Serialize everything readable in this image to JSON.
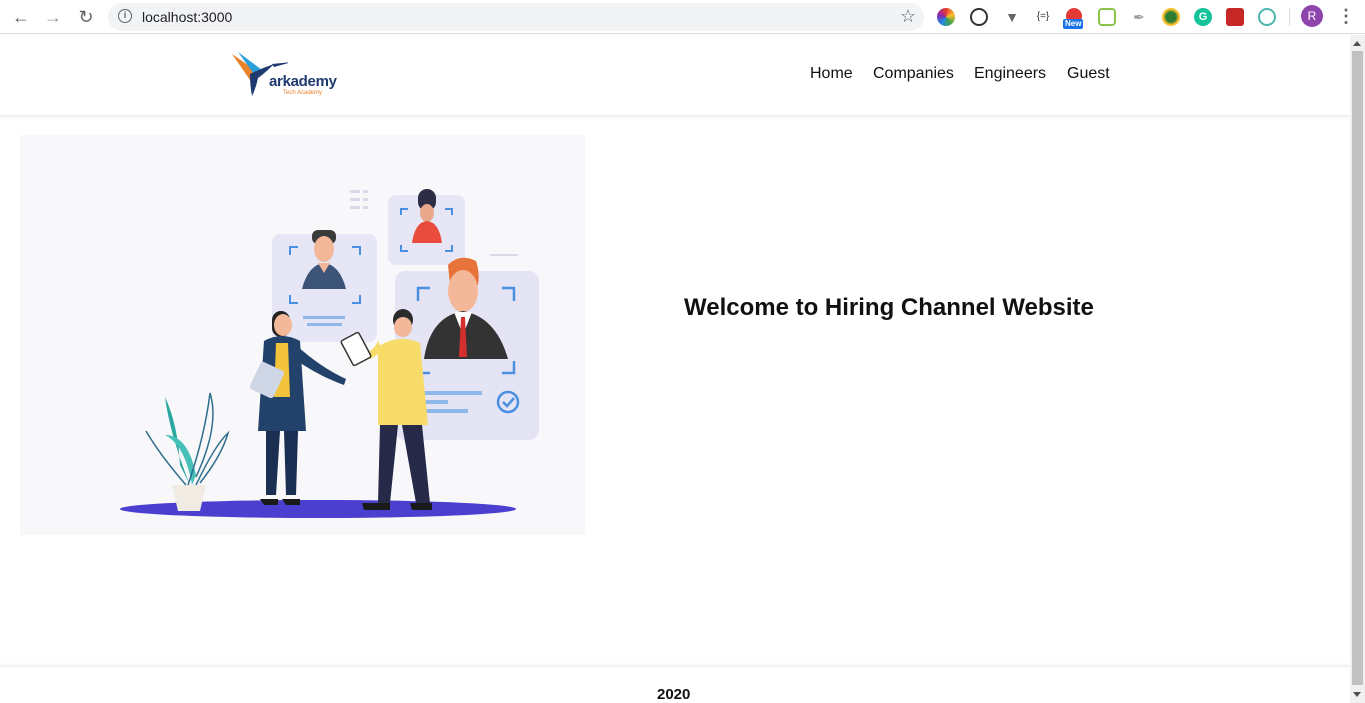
{
  "browser": {
    "url": "localhost:3000",
    "extension_new_badge": "New",
    "profile_initial": "R"
  },
  "site": {
    "logo": {
      "name": "arkademy",
      "tagline": "Tech Academy"
    },
    "nav": [
      "Home",
      "Companies",
      "Engineers",
      "Guest"
    ]
  },
  "main": {
    "welcome": "Welcome to Hiring Channel Website"
  },
  "footer": {
    "year": "2020"
  },
  "colors": {
    "accent_blue": "#1f3a6e",
    "accent_orange": "#e8822b",
    "illustration_purple": "#4b3fd0",
    "illustration_yellow": "#f7dc6a"
  }
}
